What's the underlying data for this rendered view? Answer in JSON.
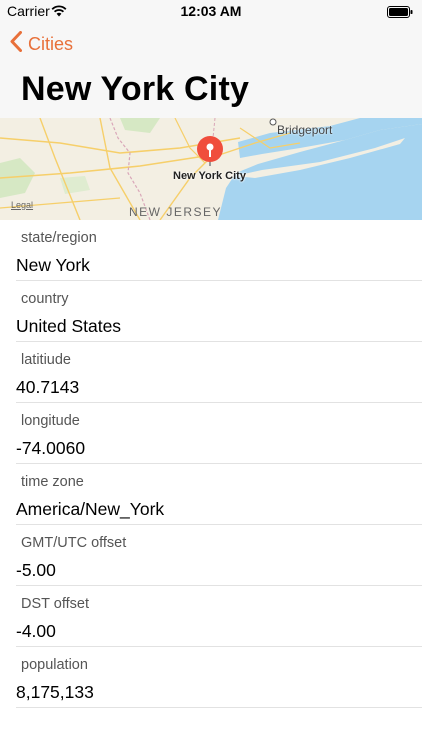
{
  "status_bar": {
    "carrier": "Carrier",
    "time": "12:03 AM",
    "icons": [
      "wifi-icon",
      "battery-icon"
    ]
  },
  "nav": {
    "back_label": "Cities",
    "title": "New York City",
    "accent_color": "#e8703a"
  },
  "map": {
    "city_label": "New York City",
    "labels": [
      "Bridgeport",
      "NEW JERSEY"
    ],
    "legal": "Legal",
    "pin_color": "#f04d3c",
    "water_color": "#a6d4f0"
  },
  "details": [
    {
      "label": "state/region",
      "value": "New York"
    },
    {
      "label": "country",
      "value": "United States"
    },
    {
      "label": "latitiude",
      "value": "40.7143"
    },
    {
      "label": "longitude",
      "value": "-74.0060"
    },
    {
      "label": "time zone",
      "value": "America/New_York"
    },
    {
      "label": "GMT/UTC offset",
      "value": "-5.00"
    },
    {
      "label": "DST offset",
      "value": "-4.00"
    },
    {
      "label": "population",
      "value": "8,175,133"
    }
  ]
}
